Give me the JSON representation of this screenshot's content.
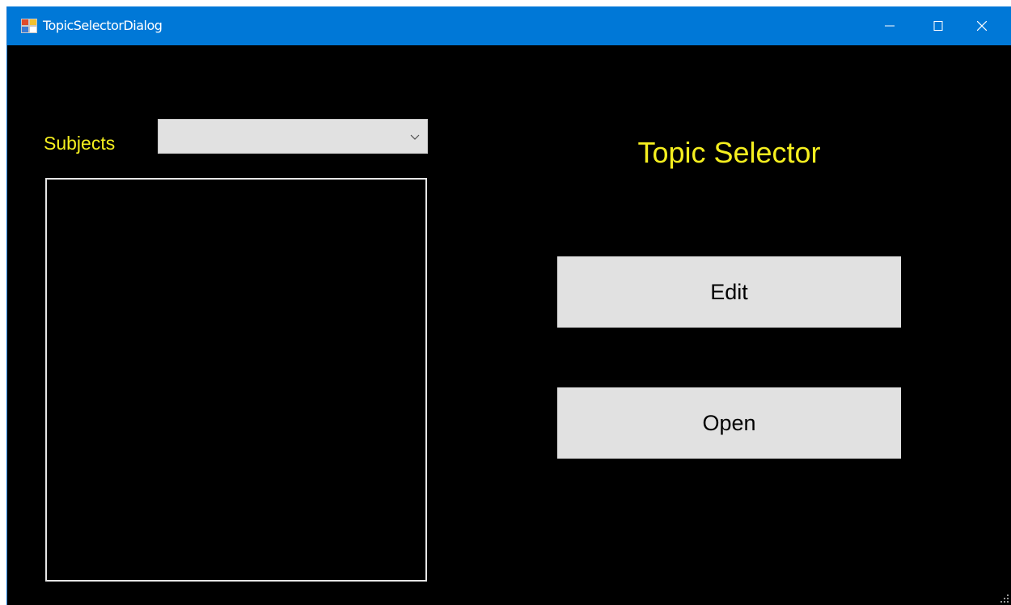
{
  "window": {
    "title": "TopicSelectorDialog",
    "controls": {
      "minimize_icon": "minimize-icon",
      "maximize_icon": "maximize-icon",
      "close_icon": "close-icon"
    }
  },
  "subjects": {
    "label": "Subjects",
    "selected_value": "",
    "items": []
  },
  "header": {
    "title": "Topic Selector"
  },
  "actions": {
    "edit_label": "Edit",
    "open_label": "Open"
  },
  "colors": {
    "titlebar": "#0078d7",
    "background": "#000000",
    "accent_text": "#f5ef1f",
    "button_face": "#e1e1e1"
  }
}
